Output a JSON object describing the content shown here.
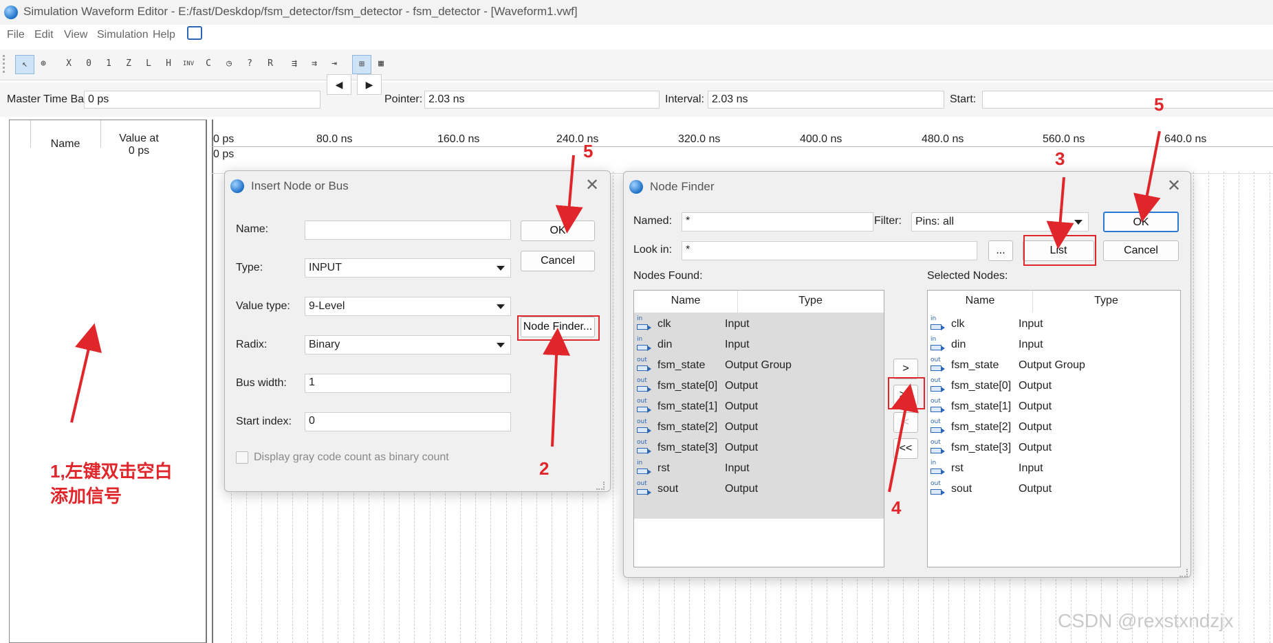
{
  "window": {
    "title": "Simulation Waveform Editor - E:/fast/Deskdop/fsm_detector/fsm_detector - fsm_detector - [Waveform1.vwf]"
  },
  "menu": {
    "items": [
      "File",
      "Edit",
      "View",
      "Simulation",
      "Help"
    ]
  },
  "toolbar": {
    "icons": [
      "select-icon",
      "zoom-icon",
      "forcing-unknown-icon",
      "forcing-low-icon",
      "forcing-high-icon",
      "high-impedance-icon",
      "weak-low-icon",
      "weak-high-icon",
      "invert-icon",
      "count-value-icon",
      "clock-icon",
      "random-value-icon",
      "arbitrary-value-icon",
      "random-icon",
      "snap-icon",
      "group-icon",
      "ungroup-icon",
      "grid-icon",
      "time-bar-icon"
    ]
  },
  "timebar": {
    "master_label": "Master Time Bar:",
    "master_value": "0 ps",
    "pointer_label": "Pointer:",
    "pointer_value": "2.03 ns",
    "interval_label": "Interval:",
    "interval_value": "2.03 ns",
    "start_label": "Start:"
  },
  "signal_table": {
    "col_name": "Name",
    "col_value": "Value at\n0 ps"
  },
  "ruler": {
    "ticks": [
      "0 ps",
      "80.0 ns",
      "160.0 ns",
      "240.0 ns",
      "320.0 ns",
      "400.0 ns",
      "480.0 ns",
      "560.0 ns",
      "640.0 ns"
    ],
    "marker": "0 ps"
  },
  "insert_dialog": {
    "title": "Insert Node or Bus",
    "name_label": "Name:",
    "name_value": "",
    "type_label": "Type:",
    "type_value": "INPUT",
    "value_type_label": "Value type:",
    "value_type_value": "9-Level",
    "radix_label": "Radix:",
    "radix_value": "Binary",
    "bus_width_label": "Bus width:",
    "bus_width_value": "1",
    "start_index_label": "Start index:",
    "start_index_value": "0",
    "gray_code_label": "Display gray code count as binary count",
    "ok": "OK",
    "cancel": "Cancel",
    "node_finder": "Node Finder..."
  },
  "node_finder": {
    "title": "Node Finder",
    "named_label": "Named:",
    "named_value": "*",
    "filter_label": "Filter:",
    "filter_value": "Pins: all",
    "look_in_label": "Look in:",
    "look_in_value": "*",
    "browse": "...",
    "list": "List",
    "ok": "OK",
    "cancel": "Cancel",
    "found_label": "Nodes Found:",
    "selected_label": "Selected Nodes:",
    "col_name": "Name",
    "col_type": "Type",
    "move_one": ">",
    "move_all": ">>",
    "remove_one": "<",
    "remove_all": "<<",
    "nodes": [
      {
        "dir": "in",
        "name": "clk",
        "type": "Input"
      },
      {
        "dir": "in",
        "name": "din",
        "type": "Input"
      },
      {
        "dir": "out",
        "name": "fsm_state",
        "type": "Output Group"
      },
      {
        "dir": "out",
        "name": "fsm_state[0]",
        "type": "Output"
      },
      {
        "dir": "out",
        "name": "fsm_state[1]",
        "type": "Output"
      },
      {
        "dir": "out",
        "name": "fsm_state[2]",
        "type": "Output"
      },
      {
        "dir": "out",
        "name": "fsm_state[3]",
        "type": "Output"
      },
      {
        "dir": "in",
        "name": "rst",
        "type": "Input"
      },
      {
        "dir": "out",
        "name": "sout",
        "type": "Output"
      }
    ]
  },
  "annotations": {
    "step1": "1,左键双击空白\n添加信号",
    "step2": "2",
    "step3": "3",
    "step4": "4",
    "step5": "5"
  },
  "watermark": "CSDN @rexstxndzjx",
  "colors": {
    "annotation": "#e0262b",
    "primary_border": "#2b78d0"
  }
}
